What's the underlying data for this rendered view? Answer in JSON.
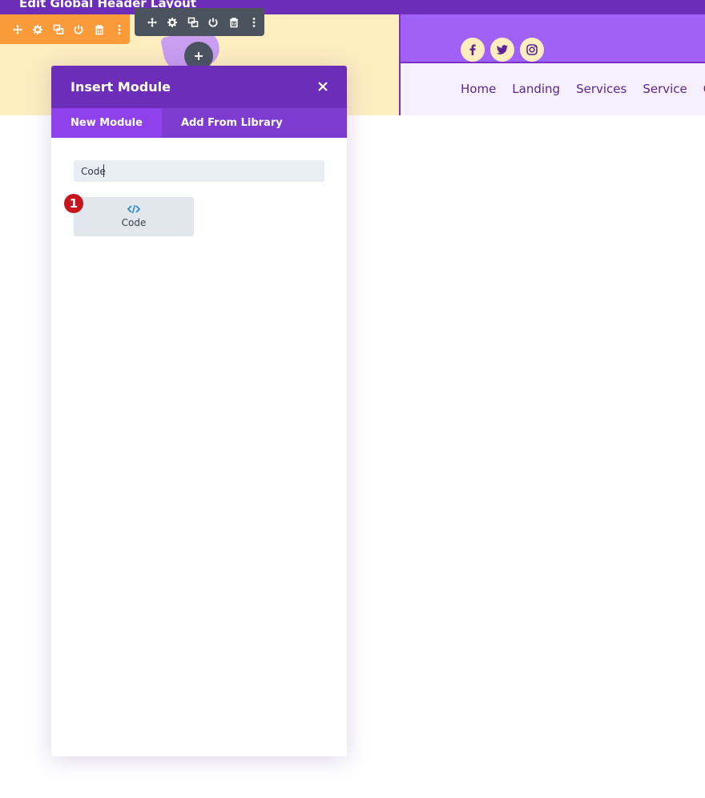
{
  "topbar": {
    "title": "Edit Global Header Layout"
  },
  "colors": {
    "accent_purple": "#6c2eb9",
    "header_yellow": "#feedbf",
    "header_purple": "#a061f6",
    "toolbar_orange": "#fb9a38",
    "toolbar_dark": "#4a535e",
    "badge_red": "#c4161c",
    "code_icon_blue": "#2e8bd6"
  },
  "header": {
    "social_icons": [
      "facebook-icon",
      "twitter-icon",
      "instagram-icon"
    ],
    "nav_items": [
      "Home",
      "Landing",
      "Services",
      "Service",
      "C"
    ]
  },
  "section_toolbar": {
    "icons": [
      "move-icon",
      "gear-icon",
      "duplicate-icon",
      "power-icon",
      "trash-icon",
      "more-icon"
    ]
  },
  "row_toolbar": {
    "icons": [
      "move-icon",
      "gear-icon",
      "duplicate-icon",
      "power-icon",
      "trash-icon",
      "more-icon"
    ]
  },
  "dialog": {
    "title": "Insert Module",
    "tabs": [
      {
        "label": "New Module",
        "active": true
      },
      {
        "label": "Add From Library",
        "active": false
      }
    ],
    "search": {
      "value": "Code",
      "placeholder": ""
    },
    "results": [
      {
        "label": "Code",
        "icon": "code-icon"
      }
    ]
  },
  "annotation": {
    "step_number": "1"
  }
}
